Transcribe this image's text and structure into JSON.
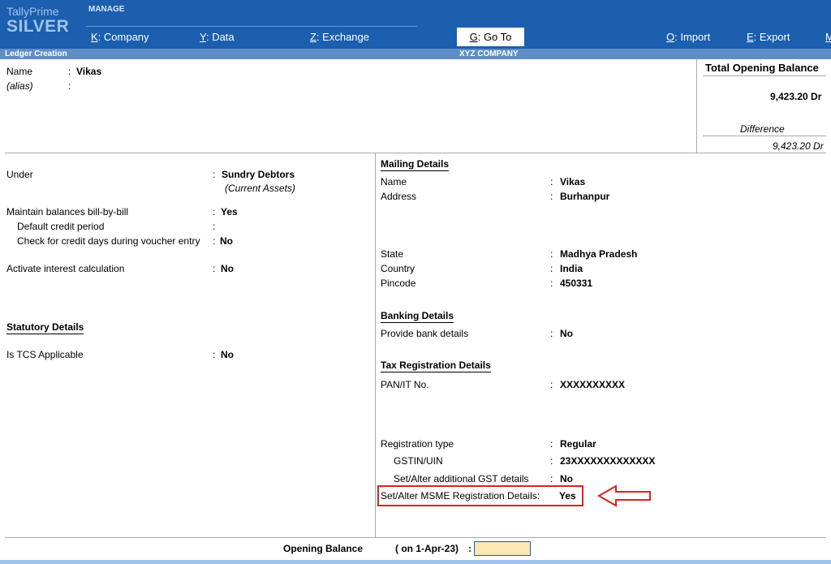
{
  "app": {
    "brand_top": "TallyPrime",
    "brand_edition": "SILVER",
    "manage_label": "MANAGE"
  },
  "menu": {
    "company": {
      "key": "K",
      "label": ": Company"
    },
    "data": {
      "key": "Y",
      "label": ": Data"
    },
    "exchange": {
      "key": "Z",
      "label": ": Exchange"
    },
    "goto": {
      "key": "G",
      "label": ": Go To"
    },
    "import": {
      "key": "O",
      "label": ": Import"
    },
    "export": {
      "key": "E",
      "label": ": Export"
    },
    "more": {
      "key": "M",
      "label": ""
    }
  },
  "strip": {
    "screen_title": "Ledger Creation",
    "company_name": "XYZ COMPANY"
  },
  "ledger": {
    "name_label": "Name",
    "name_sep": ":",
    "name_value": "Vikas",
    "alias_label": "(alias)",
    "alias_sep": ":"
  },
  "balance_panel": {
    "title": "Total Opening Balance",
    "total": "9,423.20 Dr",
    "difference_label": "Difference",
    "difference": "9,423.20 Dr"
  },
  "left": {
    "under_label": "Under",
    "under_value": "Sundry Debtors",
    "under_group": "(Current Assets)",
    "bill_label": "Maintain balances bill-by-bill",
    "bill_value": "Yes",
    "credit_period_label": "Default credit period",
    "check_credit_label": "Check for credit days during voucher entry",
    "check_credit_value": "No",
    "interest_label": "Activate interest calculation",
    "interest_value": "No",
    "statutory_title": "Statutory Details",
    "tcs_label": "Is TCS Applicable",
    "tcs_value": "No"
  },
  "mailing": {
    "title": "Mailing Details",
    "name_label": "Name",
    "name_value": "Vikas",
    "address_label": "Address",
    "address_value": "Burhanpur",
    "state_label": "State",
    "state_value": "Madhya Pradesh",
    "country_label": "Country",
    "country_value": "India",
    "pincode_label": "Pincode",
    "pincode_value": "450331"
  },
  "banking": {
    "title": "Banking Details",
    "provide_label": "Provide bank details",
    "provide_value": "No"
  },
  "tax": {
    "title": "Tax Registration Details",
    "pan_label": "PAN/IT No.",
    "pan_value": "XXXXXXXXXX",
    "reg_type_label": "Registration type",
    "reg_type_value": "Regular",
    "gstin_label": "GSTIN/UIN",
    "gstin_value": "23XXXXXXXXXXXXX",
    "gst_details_label": "Set/Alter additional GST details",
    "gst_details_value": "No",
    "msme_label": "Set/Alter MSME Registration Details:",
    "msme_value": "Yes"
  },
  "opening_balance": {
    "label": "Opening Balance",
    "date": "( on 1-Apr-23)",
    "sep": ":",
    "value": ""
  },
  "colors": {
    "header_bg": "#1b5fae",
    "strip_bg": "#5f8dc8",
    "highlight": "#e02020",
    "input_bg": "#fbe7b2"
  }
}
